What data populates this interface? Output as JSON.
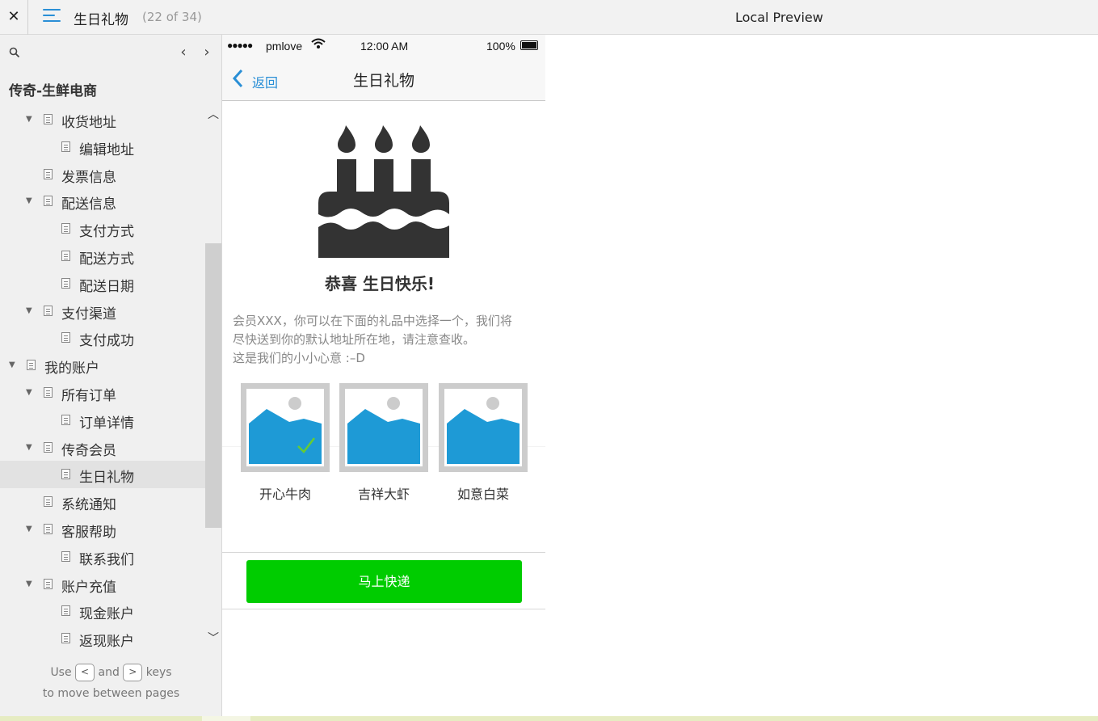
{
  "topbar": {
    "close_label": "✕",
    "title": "生日礼物",
    "page_count": "(22 of 34)",
    "preview_label": "Local Preview"
  },
  "sidebar": {
    "project_title": "传奇-生鲜电商",
    "prev_glyph": "‹",
    "next_glyph": "›",
    "items": [
      {
        "label": "收货地址",
        "level": 1,
        "expanded": true
      },
      {
        "label": "编辑地址",
        "level": 2
      },
      {
        "label": "发票信息",
        "level": 1
      },
      {
        "label": "配送信息",
        "level": 1,
        "expanded": true
      },
      {
        "label": "支付方式",
        "level": 2
      },
      {
        "label": "配送方式",
        "level": 2
      },
      {
        "label": "配送日期",
        "level": 2
      },
      {
        "label": "支付渠道",
        "level": 1,
        "expanded": true
      },
      {
        "label": "支付成功",
        "level": 2
      },
      {
        "label": "我的账户",
        "level": 0,
        "expanded": true
      },
      {
        "label": "所有订单",
        "level": 1,
        "expanded": true
      },
      {
        "label": "订单详情",
        "level": 2
      },
      {
        "label": "传奇会员",
        "level": 1,
        "expanded": true
      },
      {
        "label": "生日礼物",
        "level": 2,
        "selected": true
      },
      {
        "label": "系统通知",
        "level": 1
      },
      {
        "label": "客服帮助",
        "level": 1,
        "expanded": true
      },
      {
        "label": "联系我们",
        "level": 2
      },
      {
        "label": "账户充值",
        "level": 1,
        "expanded": true
      },
      {
        "label": "现金账户",
        "level": 2
      },
      {
        "label": "返现账户",
        "level": 2
      }
    ],
    "hint": {
      "use": "Use",
      "key_prev": "<",
      "and": "and",
      "key_next": ">",
      "keys": "keys",
      "line2": "to move between pages"
    }
  },
  "phone": {
    "status": {
      "signal": "●●●●●",
      "carrier": "pmlove",
      "time": "12:00 AM",
      "battery": "100%"
    },
    "nav": {
      "back_label": "返回",
      "title": "生日礼物"
    },
    "congrats": "恭喜 生日快乐!",
    "message_line1": "会员XXX，你可以在下面的礼品中选择一个，我们将",
    "message_line2": "尽快送到你的默认地址所在地，请注意查收。",
    "message_line3": "这是我们的小小心意 :–D",
    "gifts": [
      {
        "label": "开心牛肉",
        "selected": true
      },
      {
        "label": "吉祥大虾",
        "selected": false
      },
      {
        "label": "如意白菜",
        "selected": false
      }
    ],
    "ship_button": "马上快递"
  },
  "colors": {
    "accent_blue": "#2a8fd6",
    "button_green": "#00cc00",
    "image_blue": "#1e9ad6",
    "check_green": "#66cc33",
    "cake_dark": "#333333"
  }
}
